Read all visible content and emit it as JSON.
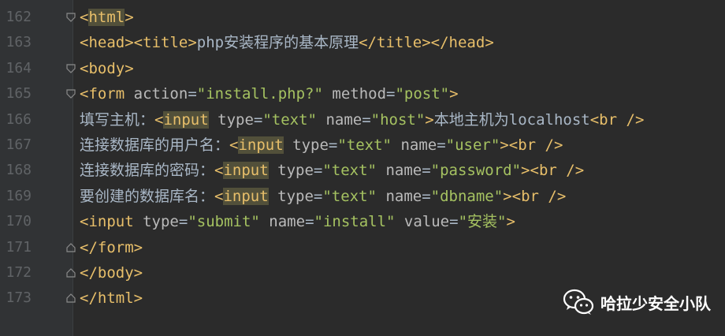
{
  "watermark": {
    "text": "哈拉少安全小队",
    "icon": "wechat-icon"
  },
  "lines": [
    {
      "num": "162",
      "fold": "open",
      "t": [
        {
          "c": "bracket",
          "s": "<"
        },
        {
          "c": "tag hl",
          "s": "html"
        },
        {
          "c": "bracket",
          "s": ">"
        }
      ]
    },
    {
      "num": "163",
      "fold": "",
      "t": [
        {
          "c": "bracket",
          "s": "<"
        },
        {
          "c": "tag",
          "s": "head"
        },
        {
          "c": "bracket",
          "s": ">"
        },
        {
          "c": "bracket",
          "s": "<"
        },
        {
          "c": "tag",
          "s": "title"
        },
        {
          "c": "bracket",
          "s": ">"
        },
        {
          "c": "txt",
          "s": "php安装程序的基本原理"
        },
        {
          "c": "bracket",
          "s": "</"
        },
        {
          "c": "tag",
          "s": "title"
        },
        {
          "c": "bracket",
          "s": ">"
        },
        {
          "c": "bracket",
          "s": "</"
        },
        {
          "c": "tag",
          "s": "head"
        },
        {
          "c": "bracket",
          "s": ">"
        }
      ]
    },
    {
      "num": "164",
      "fold": "open",
      "t": [
        {
          "c": "bracket",
          "s": "<"
        },
        {
          "c": "tag",
          "s": "body"
        },
        {
          "c": "bracket",
          "s": ">"
        }
      ]
    },
    {
      "num": "165",
      "fold": "open",
      "t": [
        {
          "c": "bracket",
          "s": "<"
        },
        {
          "c": "tag",
          "s": "form"
        },
        {
          "c": "txt",
          "s": " "
        },
        {
          "c": "attr",
          "s": "action"
        },
        {
          "c": "txt",
          "s": "="
        },
        {
          "c": "val",
          "s": "\"install.php?\""
        },
        {
          "c": "txt",
          "s": " "
        },
        {
          "c": "attr",
          "s": "method"
        },
        {
          "c": "txt",
          "s": "="
        },
        {
          "c": "val",
          "s": "\"post\""
        },
        {
          "c": "bracket",
          "s": ">"
        }
      ]
    },
    {
      "num": "166",
      "fold": "",
      "t": [
        {
          "c": "txt",
          "s": "填写主机："
        },
        {
          "c": "bracket",
          "s": "<"
        },
        {
          "c": "tag hl",
          "s": "input"
        },
        {
          "c": "txt",
          "s": " "
        },
        {
          "c": "attr",
          "s": "type"
        },
        {
          "c": "txt",
          "s": "="
        },
        {
          "c": "val",
          "s": "\"text\""
        },
        {
          "c": "txt",
          "s": " "
        },
        {
          "c": "attr",
          "s": "name"
        },
        {
          "c": "txt",
          "s": "="
        },
        {
          "c": "val",
          "s": "\"host\""
        },
        {
          "c": "bracket",
          "s": ">"
        },
        {
          "c": "txt",
          "s": "本地主机为localhost"
        },
        {
          "c": "bracket",
          "s": "<"
        },
        {
          "c": "tag",
          "s": "br"
        },
        {
          "c": "txt",
          "s": " "
        },
        {
          "c": "bracket",
          "s": "/>"
        }
      ]
    },
    {
      "num": "167",
      "fold": "",
      "t": [
        {
          "c": "txt",
          "s": "连接数据库的用户名："
        },
        {
          "c": "bracket",
          "s": "<"
        },
        {
          "c": "tag hl",
          "s": "input"
        },
        {
          "c": "txt",
          "s": " "
        },
        {
          "c": "attr",
          "s": "type"
        },
        {
          "c": "txt",
          "s": "="
        },
        {
          "c": "val",
          "s": "\"text\""
        },
        {
          "c": "txt",
          "s": " "
        },
        {
          "c": "attr",
          "s": "name"
        },
        {
          "c": "txt",
          "s": "="
        },
        {
          "c": "val",
          "s": "\"user\""
        },
        {
          "c": "bracket",
          "s": ">"
        },
        {
          "c": "bracket",
          "s": "<"
        },
        {
          "c": "tag",
          "s": "br"
        },
        {
          "c": "txt",
          "s": " "
        },
        {
          "c": "bracket",
          "s": "/>"
        }
      ]
    },
    {
      "num": "168",
      "fold": "",
      "t": [
        {
          "c": "txt",
          "s": "连接数据库的密码："
        },
        {
          "c": "bracket",
          "s": "<"
        },
        {
          "c": "tag hl",
          "s": "input"
        },
        {
          "c": "txt",
          "s": " "
        },
        {
          "c": "attr",
          "s": "type"
        },
        {
          "c": "txt",
          "s": "="
        },
        {
          "c": "val",
          "s": "\"text\""
        },
        {
          "c": "txt",
          "s": " "
        },
        {
          "c": "attr",
          "s": "name"
        },
        {
          "c": "txt",
          "s": "="
        },
        {
          "c": "val",
          "s": "\"password\""
        },
        {
          "c": "bracket",
          "s": ">"
        },
        {
          "c": "bracket",
          "s": "<"
        },
        {
          "c": "tag",
          "s": "br"
        },
        {
          "c": "txt",
          "s": " "
        },
        {
          "c": "bracket",
          "s": "/>"
        }
      ]
    },
    {
      "num": "169",
      "fold": "",
      "t": [
        {
          "c": "txt",
          "s": "要创建的数据库名："
        },
        {
          "c": "bracket",
          "s": "<"
        },
        {
          "c": "tag hl",
          "s": "input"
        },
        {
          "c": "txt",
          "s": " "
        },
        {
          "c": "attr",
          "s": "type"
        },
        {
          "c": "txt",
          "s": "="
        },
        {
          "c": "val",
          "s": "\"text\""
        },
        {
          "c": "txt",
          "s": " "
        },
        {
          "c": "attr",
          "s": "name"
        },
        {
          "c": "txt",
          "s": "="
        },
        {
          "c": "val",
          "s": "\"dbname\""
        },
        {
          "c": "bracket",
          "s": ">"
        },
        {
          "c": "bracket",
          "s": "<"
        },
        {
          "c": "tag",
          "s": "br"
        },
        {
          "c": "txt",
          "s": " "
        },
        {
          "c": "bracket",
          "s": "/>"
        }
      ]
    },
    {
      "num": "170",
      "fold": "",
      "t": [
        {
          "c": "bracket",
          "s": "<"
        },
        {
          "c": "tag",
          "s": "input"
        },
        {
          "c": "txt",
          "s": " "
        },
        {
          "c": "attr",
          "s": "type"
        },
        {
          "c": "txt",
          "s": "="
        },
        {
          "c": "val",
          "s": "\"submit\""
        },
        {
          "c": "txt",
          "s": " "
        },
        {
          "c": "attr",
          "s": "name"
        },
        {
          "c": "txt",
          "s": "="
        },
        {
          "c": "val",
          "s": "\"install\""
        },
        {
          "c": "txt",
          "s": " "
        },
        {
          "c": "attr",
          "s": "value"
        },
        {
          "c": "txt",
          "s": "="
        },
        {
          "c": "val",
          "s": "\"安装\""
        },
        {
          "c": "bracket",
          "s": ">"
        }
      ]
    },
    {
      "num": "171",
      "fold": "close",
      "t": [
        {
          "c": "bracket",
          "s": "</"
        },
        {
          "c": "tag",
          "s": "form"
        },
        {
          "c": "bracket",
          "s": ">"
        }
      ]
    },
    {
      "num": "172",
      "fold": "close",
      "t": [
        {
          "c": "bracket",
          "s": "</"
        },
        {
          "c": "tag",
          "s": "body"
        },
        {
          "c": "bracket",
          "s": ">"
        }
      ]
    },
    {
      "num": "173",
      "fold": "close",
      "t": [
        {
          "c": "bracket",
          "s": "</"
        },
        {
          "c": "tag",
          "s": "html"
        },
        {
          "c": "bracket",
          "s": ">"
        }
      ]
    }
  ]
}
